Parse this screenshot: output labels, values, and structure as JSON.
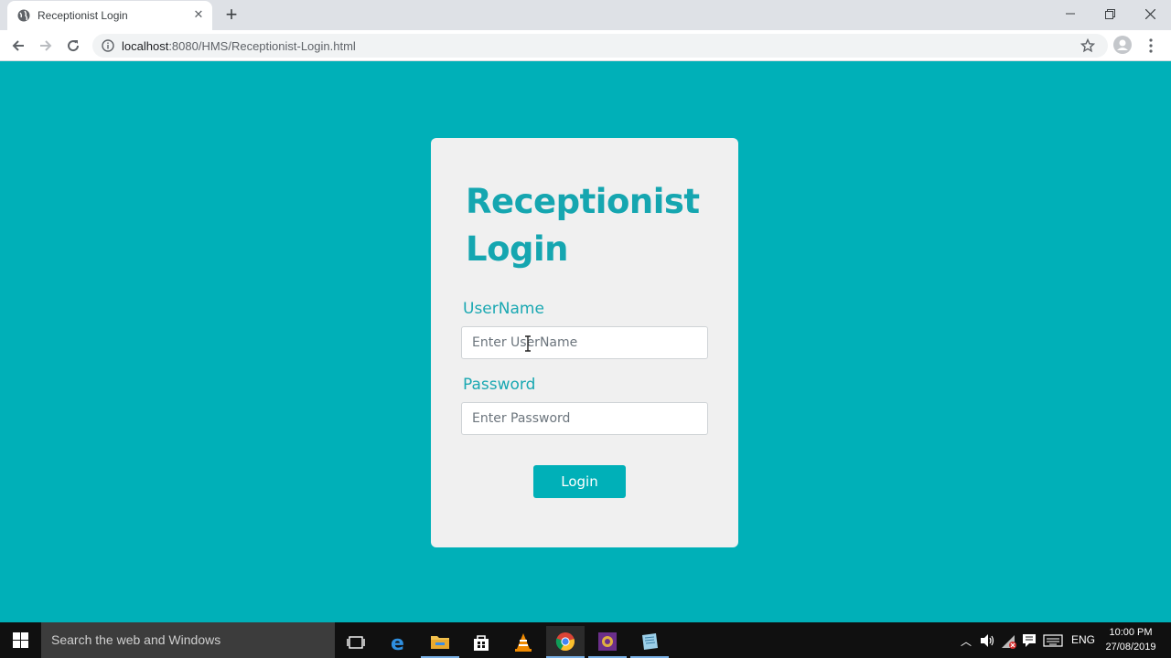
{
  "browser": {
    "tab_title": "Receptionist Login",
    "url_host": "localhost",
    "url_path": ":8080/HMS/Receptionist-Login.html"
  },
  "login": {
    "title": "Receptionist Login",
    "username_label": "UserName",
    "username_placeholder": "Enter UserName",
    "password_label": "Password",
    "password_placeholder": "Enter Password",
    "login_button": "Login"
  },
  "colors": {
    "page_background": "#00b0b8",
    "card_background": "#f0f0f0",
    "accent": "#15a6b0"
  },
  "taskbar": {
    "search_placeholder": "Search the web and Windows",
    "language": "ENG",
    "time": "10:00 PM",
    "date": "27/08/2019"
  }
}
